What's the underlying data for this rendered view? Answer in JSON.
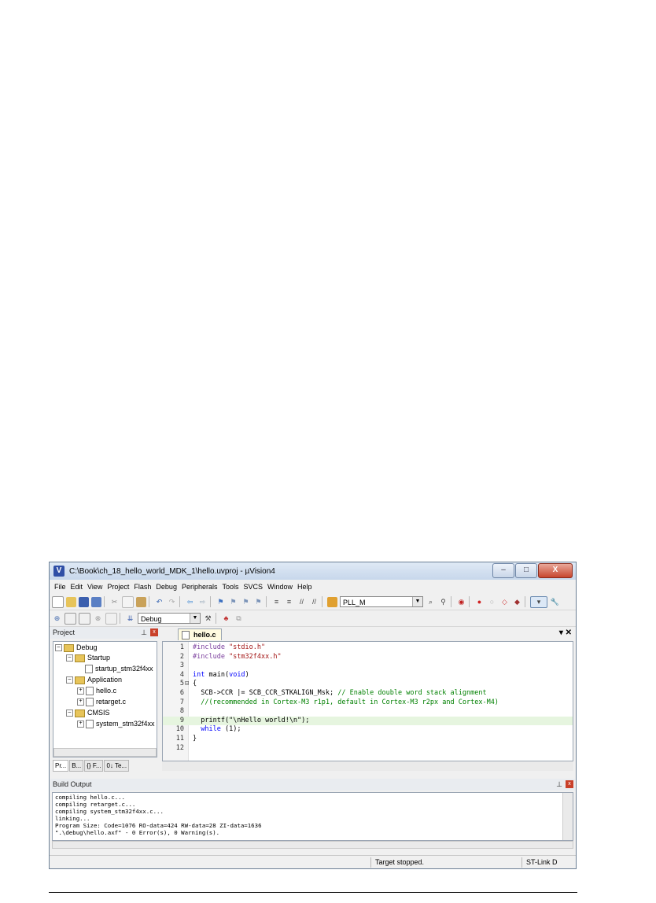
{
  "window": {
    "title": "C:\\Book\\ch_18_hello_world_MDK_1\\hello.uvproj - µVision4",
    "app_icon": "V",
    "minimize": "–",
    "maximize": "□",
    "close": "X"
  },
  "menu": [
    "File",
    "Edit",
    "View",
    "Project",
    "Flash",
    "Debug",
    "Peripherals",
    "Tools",
    "SVCS",
    "Window",
    "Help"
  ],
  "toolbar": {
    "find_combo": "PLL_M",
    "target_combo": "Debug"
  },
  "project_panel": {
    "title": "Project",
    "tree": {
      "root": "Debug",
      "startup": "Startup",
      "startup_file": "startup_stm32f4xx",
      "application": "Application",
      "hello": "hello.c",
      "retarget": "retarget.c",
      "cmsis": "CMSIS",
      "system_file": "system_stm32f4xx"
    },
    "tabs": [
      "Pr...",
      "B...",
      "{} F...",
      "0↓ Te..."
    ]
  },
  "editor": {
    "tab": "hello.c",
    "lines": [
      {
        "n": "1",
        "parts": [
          [
            "inc",
            "#include "
          ],
          [
            "str",
            "\"stdio.h\""
          ]
        ]
      },
      {
        "n": "2",
        "parts": [
          [
            "inc",
            "#include "
          ],
          [
            "str",
            "\"stm32f4xx.h\""
          ]
        ]
      },
      {
        "n": "3",
        "parts": []
      },
      {
        "n": "4",
        "parts": [
          [
            "kw",
            "int"
          ],
          [
            "",
            " main("
          ],
          [
            "kw",
            "void"
          ],
          [
            "",
            ")"
          ]
        ]
      },
      {
        "n": "5",
        "parts": [
          [
            "",
            "{"
          ]
        ]
      },
      {
        "n": "6",
        "parts": [
          [
            "",
            "  SCB->CCR |= SCB_CCR_STKALIGN_Msk; "
          ],
          [
            "cm",
            "// Enable double word stack alignment"
          ]
        ]
      },
      {
        "n": "7",
        "parts": [
          [
            "cm",
            "  //(recommended in Cortex-M3 r1p1, default in Cortex-M3 r2px and Cortex-M4)"
          ]
        ]
      },
      {
        "n": "8",
        "parts": []
      },
      {
        "n": "9",
        "parts": [
          [
            "",
            "  printf(\"\\nHello world!\\n\");"
          ]
        ]
      },
      {
        "n": "10",
        "parts": [
          [
            "",
            "  "
          ],
          [
            "kw",
            "while"
          ],
          [
            "",
            " (1);"
          ]
        ]
      },
      {
        "n": "11",
        "parts": [
          [
            "",
            "}"
          ]
        ]
      },
      {
        "n": "12",
        "parts": []
      }
    ]
  },
  "build_output": {
    "title": "Build Output",
    "lines": [
      "compiling hello.c...",
      "compiling retarget.c...",
      "compiling system_stm32f4xx.c...",
      "linking...",
      "Program Size: Code=1076 RO-data=424 RW-data=28 ZI-data=1636",
      "\".\\debug\\hello.axf\" - 0 Error(s), 0 Warning(s)."
    ]
  },
  "status": {
    "state": "Target stopped.",
    "debugger": "ST-Link D"
  }
}
